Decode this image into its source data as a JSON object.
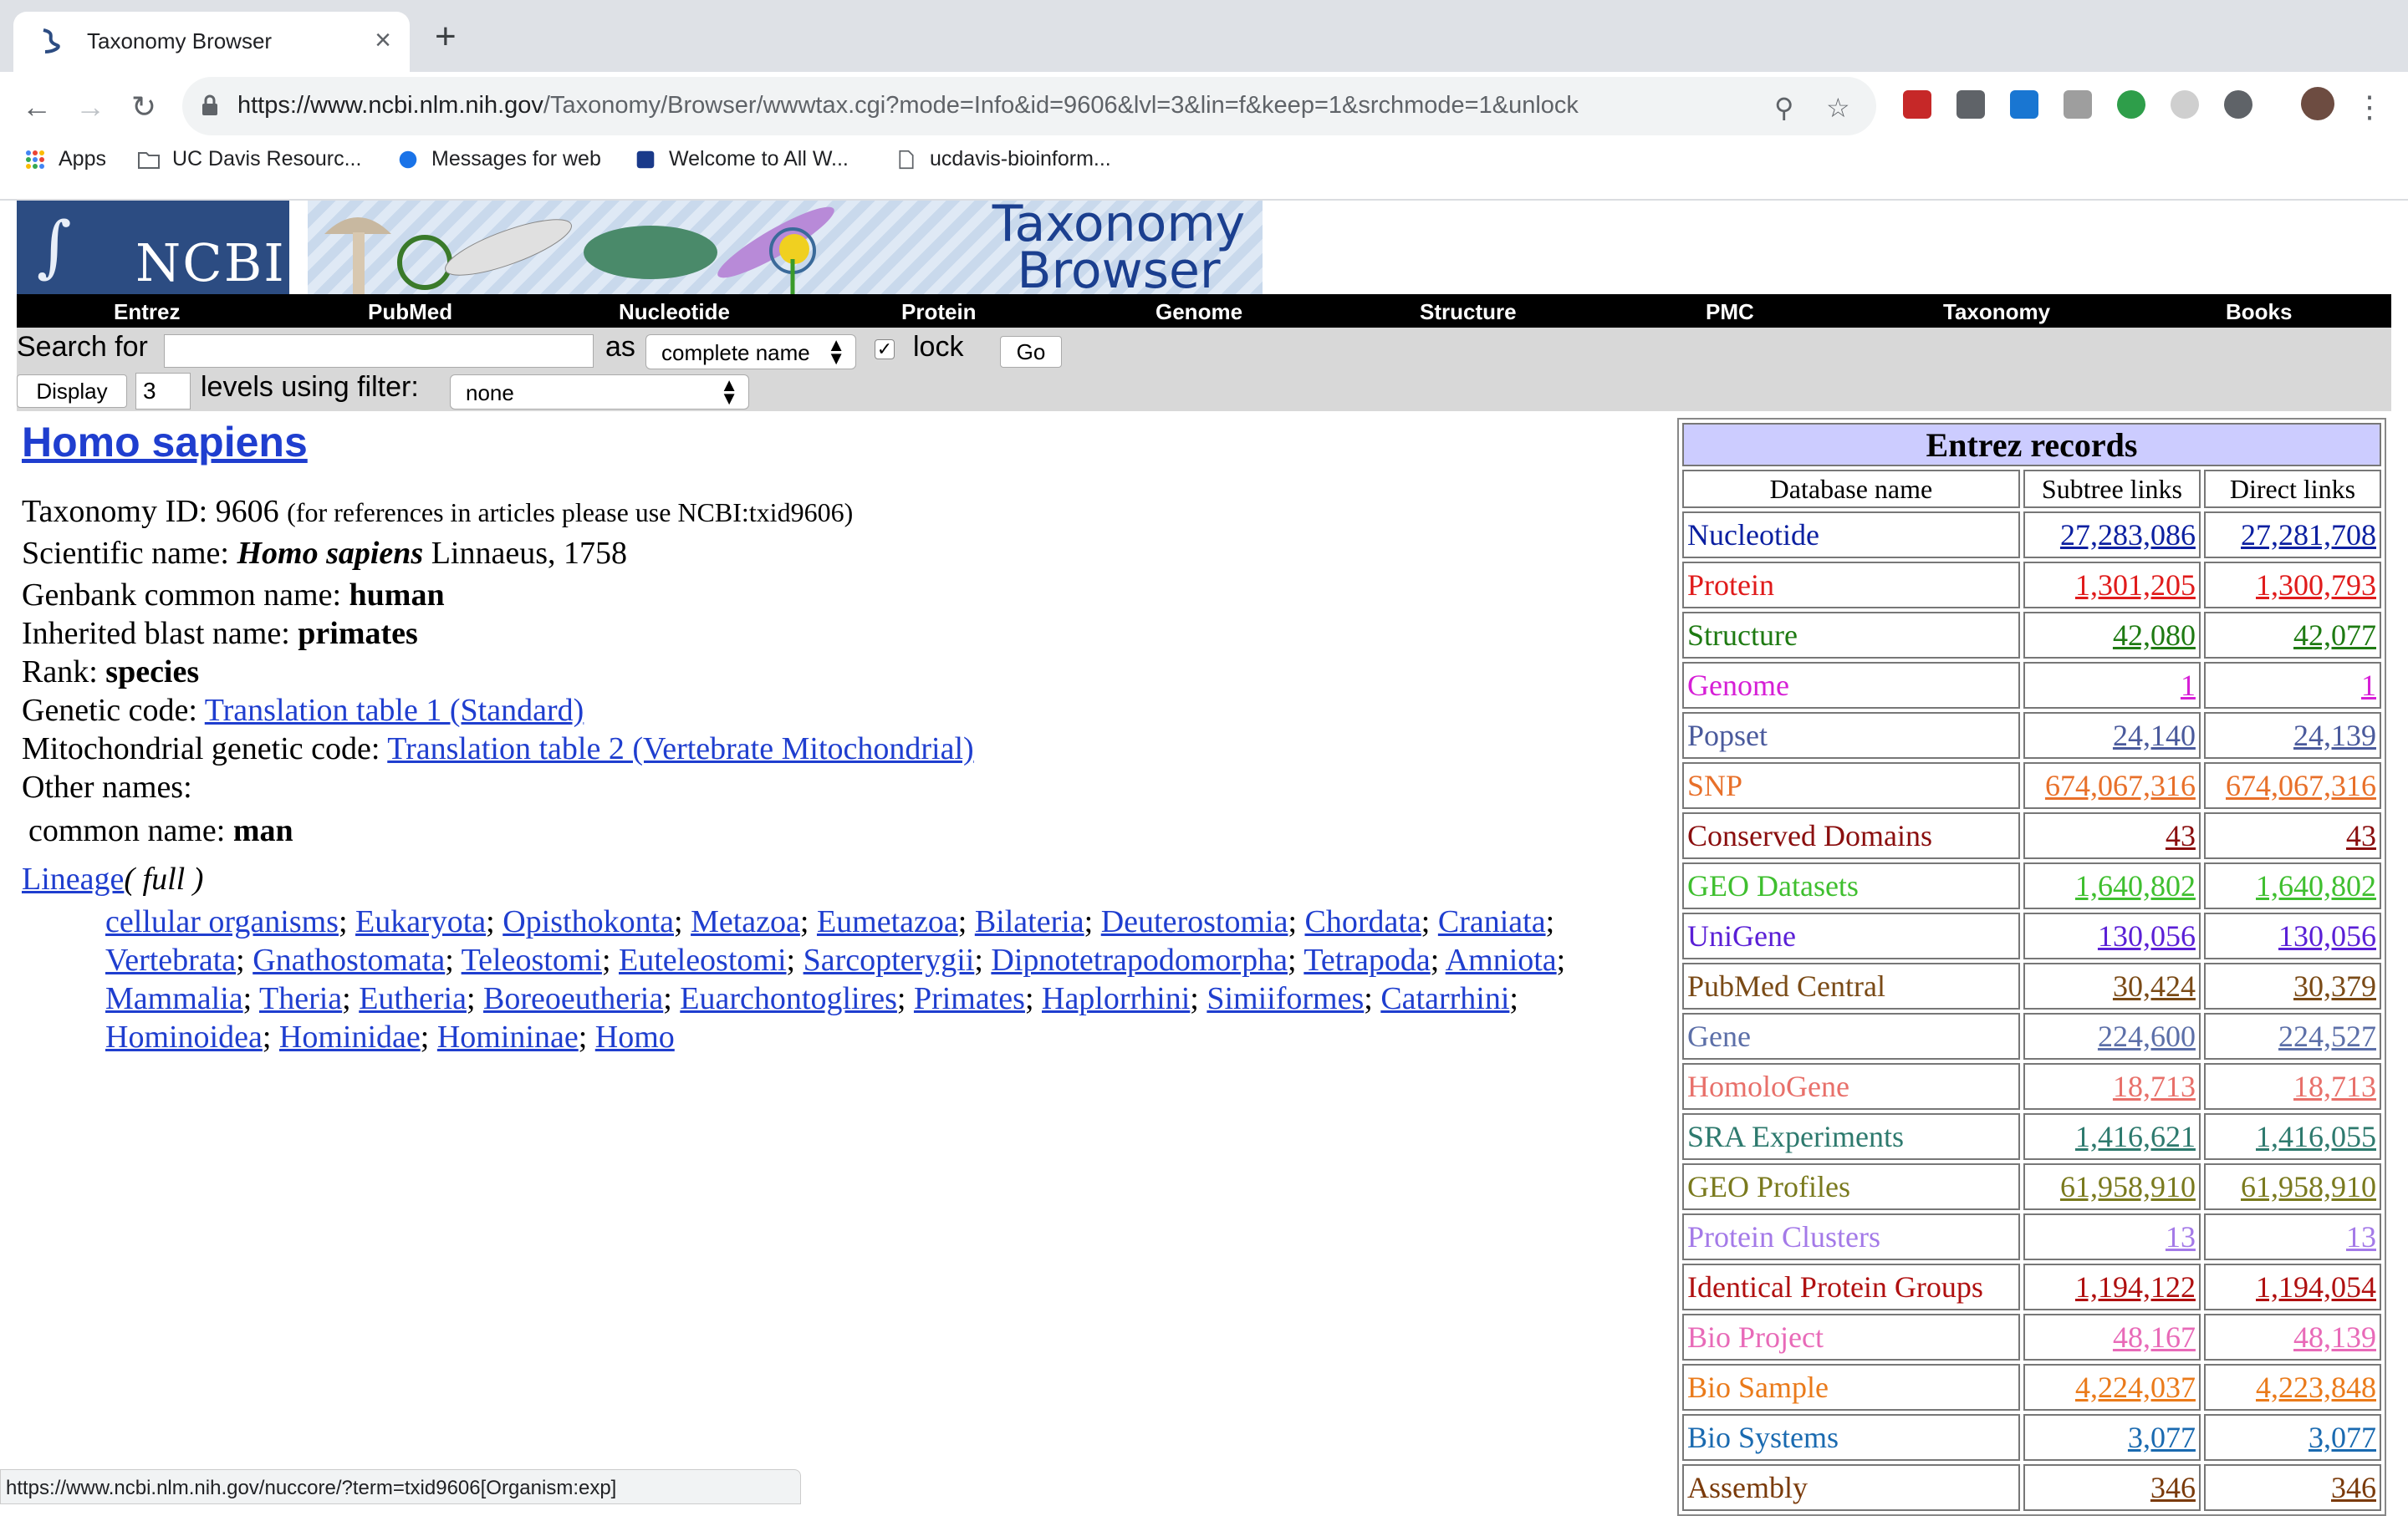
{
  "browser": {
    "tab_title": "Taxonomy Browser",
    "tab_close": "×",
    "new_tab": "+",
    "url_host": "https://www.ncbi.nlm.nih.gov",
    "url_path": "/Taxonomy/Browser/wwwtax.cgi?mode=Info&id=9606&lvl=3&lin=f&keep=1&srchmode=1&unlock",
    "bookmarks": [
      "Apps",
      "UC Davis Resourc...",
      "Messages for web",
      "Welcome to All W...",
      "ucdavis-bioinform..."
    ],
    "status_url": "https://www.ncbi.nlm.nih.gov/nuccore/?term=txid9606[Organism:exp]"
  },
  "header": {
    "ncbi_logo": "NCBI",
    "banner_line1": "Taxonomy",
    "banner_line2": "Browser",
    "menu": [
      "Entrez",
      "PubMed",
      "Nucleotide",
      "Protein",
      "Genome",
      "Structure",
      "PMC",
      "Taxonomy",
      "Books"
    ]
  },
  "search": {
    "search_label": "Search for",
    "search_value": "",
    "as_label": "as",
    "as_value": "complete name",
    "lock_label": "lock",
    "lock_checked": true,
    "go_label": "Go",
    "display_label": "Display",
    "levels_value": "3",
    "levels_label": "levels using filter:",
    "filter_value": "none"
  },
  "taxon": {
    "title": "Homo sapiens",
    "taxid_label": "Taxonomy ID: 9606",
    "taxid_note": "(for references in articles please use NCBI:txid9606)",
    "sci_label": "Scientific name:",
    "sci_name": "Homo sapiens",
    "sci_author": "Linnaeus, 1758",
    "common_label": "Genbank common name:",
    "common_value": "human",
    "blast_label": "Inherited blast name:",
    "blast_value": "primates",
    "rank_label": "Rank:",
    "rank_value": "species",
    "gc_label": "Genetic code:",
    "gc_value": "Translation table 1 (Standard)",
    "mgc_label": "Mitochondrial genetic code:",
    "mgc_value": "Translation table 2 (Vertebrate Mitochondrial)",
    "other_names": "Other names:",
    "other_common_label": "common name:",
    "other_common_value": "man",
    "lineage_label": "Lineage",
    "lineage_full": "( full )",
    "lineage": [
      "cellular organisms",
      "Eukaryota",
      "Opisthokonta",
      "Metazoa",
      "Eumetazoa",
      "Bilateria",
      "Deuterostomia",
      "Chordata",
      "Craniata",
      "Vertebrata",
      "Gnathostomata",
      "Teleostomi",
      "Euteleostomi",
      "Sarcopterygii",
      "Dipnotetrapodomorpha",
      "Tetrapoda",
      "Amniota",
      "Mammalia",
      "Theria",
      "Eutheria",
      "Boreoeutheria",
      "Euarchontoglires",
      "Primates",
      "Haplorrhini",
      "Simiiformes",
      "Catarrhini",
      "Hominoidea",
      "Hominidae",
      "Homininae",
      "Homo"
    ]
  },
  "entrez": {
    "title": "Entrez records",
    "col_db": "Database name",
    "col_subtree": "Subtree links",
    "col_direct": "Direct links",
    "rows": [
      {
        "name": "Nucleotide",
        "subtree": "27,283,086",
        "direct": "27,281,708",
        "color": "#0b1fa0"
      },
      {
        "name": "Protein",
        "subtree": "1,301,205",
        "direct": "1,300,793",
        "color": "#e01b1b"
      },
      {
        "name": "Structure",
        "subtree": "42,080",
        "direct": "42,077",
        "color": "#1e7a12"
      },
      {
        "name": "Genome",
        "subtree": "1",
        "direct": "1",
        "color": "#d61fd6"
      },
      {
        "name": "Popset",
        "subtree": "24,140",
        "direct": "24,139",
        "color": "#4a5a9c"
      },
      {
        "name": "SNP",
        "subtree": "674,067,316",
        "direct": "674,067,316",
        "color": "#e8702a"
      },
      {
        "name": "Conserved Domains",
        "subtree": "43",
        "direct": "43",
        "color": "#8a0e0e"
      },
      {
        "name": "GEO Datasets",
        "subtree": "1,640,802",
        "direct": "1,640,802",
        "color": "#3fbf2f"
      },
      {
        "name": "UniGene",
        "subtree": "130,056",
        "direct": "130,056",
        "color": "#5a1fd6"
      },
      {
        "name": "PubMed Central",
        "subtree": "30,424",
        "direct": "30,379",
        "color": "#7a4a16"
      },
      {
        "name": "Gene",
        "subtree": "224,600",
        "direct": "224,527",
        "color": "#5c6fa8"
      },
      {
        "name": "HomoloGene",
        "subtree": "18,713",
        "direct": "18,713",
        "color": "#e8706a"
      },
      {
        "name": "SRA Experiments",
        "subtree": "1,416,621",
        "direct": "1,416,055",
        "color": "#2e7a6e"
      },
      {
        "name": "GEO Profiles",
        "subtree": "61,958,910",
        "direct": "61,958,910",
        "color": "#7a7a1e"
      },
      {
        "name": "Protein Clusters",
        "subtree": "13",
        "direct": "13",
        "color": "#a47ae8"
      },
      {
        "name": "Identical Protein Groups",
        "subtree": "1,194,122",
        "direct": "1,194,054",
        "color": "#b01010"
      },
      {
        "name": "Bio Project",
        "subtree": "48,167",
        "direct": "48,139",
        "color": "#e86ab8"
      },
      {
        "name": "Bio Sample",
        "subtree": "4,224,037",
        "direct": "4,223,848",
        "color": "#ea7a1a"
      },
      {
        "name": "Bio Systems",
        "subtree": "3,077",
        "direct": "3,077",
        "color": "#1a6ab0"
      },
      {
        "name": "Assembly",
        "subtree": "346",
        "direct": "346",
        "color": "#7a3a0a"
      }
    ]
  }
}
